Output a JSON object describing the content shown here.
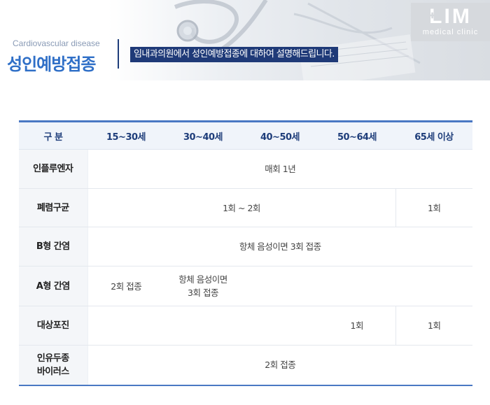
{
  "header": {
    "subtitle_en": "Cardiovascular disease",
    "title": "성인예방접종",
    "description": "임내과의원에서 성인예방접종에 대하여 설명해드립니다.",
    "logo_main": "LIM",
    "logo_sub": "medical clinic"
  },
  "table": {
    "headers": [
      "구 분",
      "15~30세",
      "30~40세",
      "40~50세",
      "50~64세",
      "65세 이상"
    ],
    "rows": [
      {
        "label": "인플루엔자",
        "cells": [
          "매회 1년"
        ]
      },
      {
        "label": "폐렴구균",
        "cells": [
          "1회 ~ 2회",
          "1회"
        ]
      },
      {
        "label": "B형 간염",
        "cells": [
          "항체 음성이면 3회 접종"
        ]
      },
      {
        "label": "A형 간염",
        "cells": [
          "2회 접종",
          "항체 음성이면",
          "3회 접종",
          ""
        ]
      },
      {
        "label": "대상포진",
        "cells": [
          "",
          "1회",
          "1회"
        ]
      },
      {
        "label_line1": "인유두종",
        "label_line2": "바이러스",
        "cells": [
          "2회 접종"
        ]
      }
    ]
  },
  "colors": {
    "title_blue": "#2f6fc7",
    "navy": "#1f3a78",
    "table_border": "#4a78c3",
    "header_bg": "#f0f4fa"
  }
}
